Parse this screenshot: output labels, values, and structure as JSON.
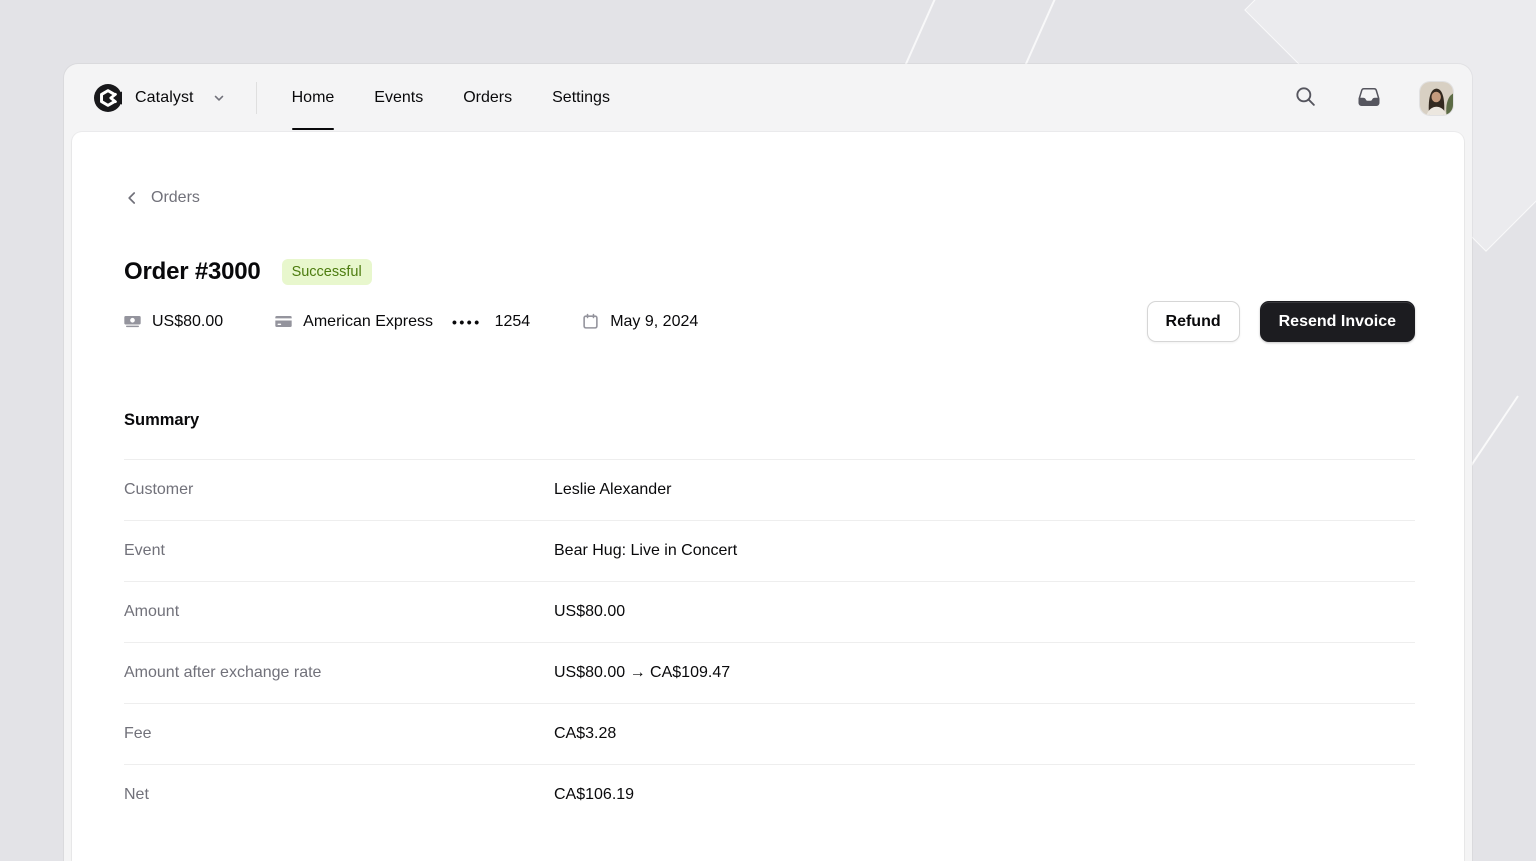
{
  "brand": {
    "name": "Catalyst"
  },
  "nav": {
    "items": [
      {
        "label": "Home",
        "active": true
      },
      {
        "label": "Events",
        "active": false
      },
      {
        "label": "Orders",
        "active": false
      },
      {
        "label": "Settings",
        "active": false
      }
    ]
  },
  "icons": {
    "brand_logo": "catalyst-hexagon-mark",
    "brand_caret": "chevron-down",
    "search": "magnifying-glass",
    "inbox": "inbox-tray",
    "breadcrumb_back": "chevron-left",
    "amount": "banknote",
    "payment": "credit-card",
    "date": "calendar"
  },
  "breadcrumb": {
    "label": "Orders"
  },
  "order": {
    "title": "Order #3000",
    "status": "Successful",
    "amount": "US$80.00",
    "payment_method": "American Express",
    "card_dots": "••••",
    "card_last4": "1254",
    "date": "May 9, 2024"
  },
  "actions": {
    "refund_label": "Refund",
    "resend_label": "Resend Invoice"
  },
  "summary": {
    "heading": "Summary",
    "rows": [
      {
        "label": "Customer",
        "value": "Leslie Alexander"
      },
      {
        "label": "Event",
        "value": "Bear Hug: Live in Concert"
      },
      {
        "label": "Amount",
        "value": "US$80.00"
      },
      {
        "label": "Amount after exchange rate",
        "value": "US$80.00 → CA$109.47"
      },
      {
        "label": "Fee",
        "value": "CA$3.28"
      },
      {
        "label": "Net",
        "value": "CA$106.19"
      }
    ]
  },
  "colors": {
    "status_badge_bg": "#e8f7cd",
    "status_badge_text": "#4d7c0f",
    "primary_button_bg": "#1c1c20",
    "page_background": "#e3e3e7",
    "shell_background": "#f4f4f5"
  }
}
